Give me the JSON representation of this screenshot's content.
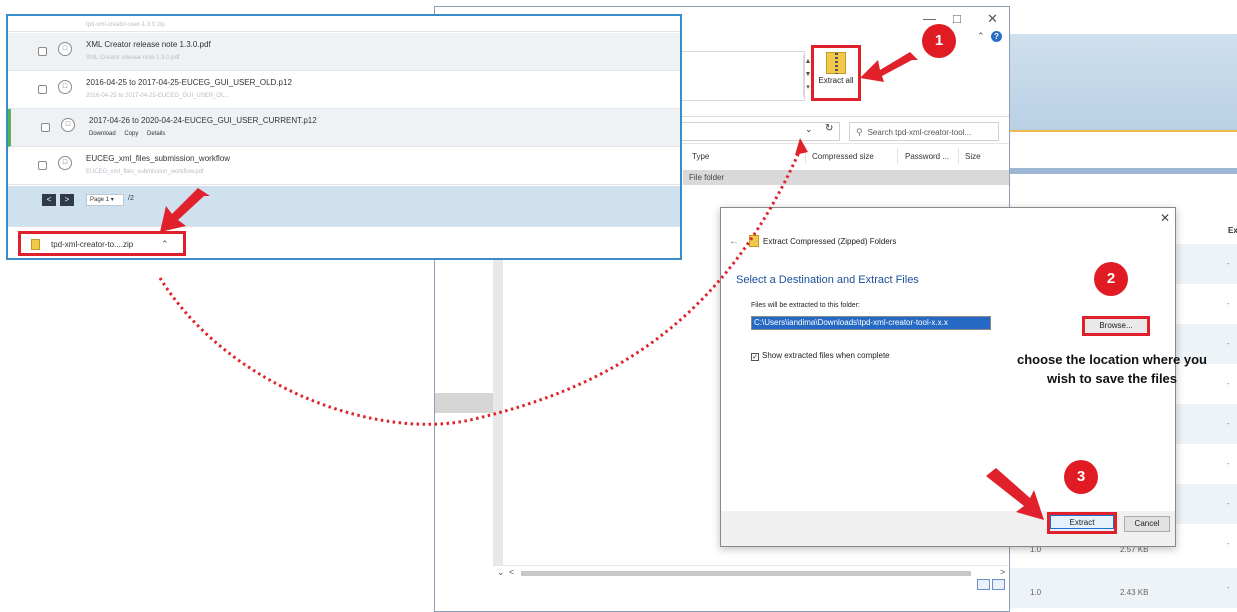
{
  "browser": {
    "items": [
      {
        "name": "tpd-xml-creator-user-1.3.0.zip",
        "sub": ""
      },
      {
        "name": "XML Creator release note 1.3.0.pdf",
        "sub": "XML Creator release note 1.3.0.pdf"
      },
      {
        "name": "2016-04-25 to 2017-04-25-EUCEG_GUI_USER_OLD.p12",
        "sub": "2016-04-25 to 2017-04-25-EUCEG_GUI_USER_OL..."
      },
      {
        "name": "2017-04-26 to 2020-04-24-EUCEG_GUI_USER_CURRENT.p12",
        "actions": [
          "Download",
          "Copy",
          "Details"
        ]
      },
      {
        "name": "EUCEG_xml_files_submission_workflow",
        "sub": "EUCEG_xml_files_submission_workflow.pdf"
      }
    ],
    "pager": {
      "prev": "<",
      "next": ">",
      "page": "Page 1",
      "total": "/2"
    },
    "download": {
      "file": "tpd-xml-creator-to....zip"
    }
  },
  "explorer": {
    "extract_all": "Extract all",
    "search_placeholder": "Search tpd-xml-creator-tool...",
    "columns": [
      "Type",
      "Compressed size",
      "Password ...",
      "Size"
    ],
    "row_type": "File folder"
  },
  "dialog": {
    "title": "Extract Compressed (Zipped) Folders",
    "heading": "Select a Destination and Extract Files",
    "path_label": "Files will be extracted to this folder:",
    "path_value": "C:\\Users\\iandima\\Downloads\\tpd-xml-creator-tool-x.x.x",
    "browse": "Browse...",
    "show_files": "Show extracted files when complete",
    "extract": "Extract",
    "cancel": "Cancel"
  },
  "annotations": {
    "hint": "choose the location where you wish to save the files",
    "steps": [
      "1",
      "2",
      "3"
    ]
  },
  "background": {
    "col_head": "Ex",
    "dash": "-",
    "sizes": [
      {
        "version": "1.0",
        "size": "2.57 KB"
      },
      {
        "version": "1.0",
        "size": "2.43 KB"
      }
    ]
  },
  "colors": {
    "highlight": "#e0202a",
    "step": "#e01b24",
    "frame": "#3a8cc8"
  }
}
